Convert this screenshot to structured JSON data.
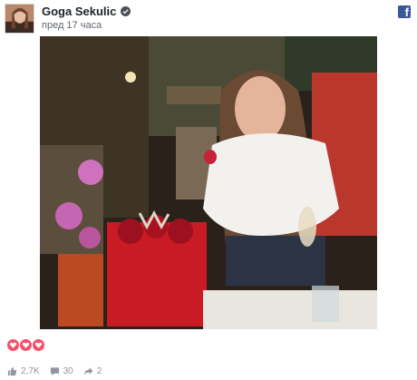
{
  "post": {
    "author": "Goga Sekulic",
    "timestamp": "пред 17 часа",
    "verified": true
  },
  "icons": {
    "avatar": "profile-avatar",
    "platform": "facebook-logo",
    "verified": "verified-badge-icon",
    "reaction": "heart-icon",
    "like": "thumbs-up-icon",
    "comment": "comment-icon",
    "share": "share-icon"
  },
  "reactions": {
    "count": 3,
    "type": "heart"
  },
  "stats": {
    "likes": "2,7K",
    "comments": "30",
    "shares": "2"
  },
  "colors": {
    "brand": "#3b5998",
    "heart": "#f25268",
    "meta": "#90949c"
  }
}
